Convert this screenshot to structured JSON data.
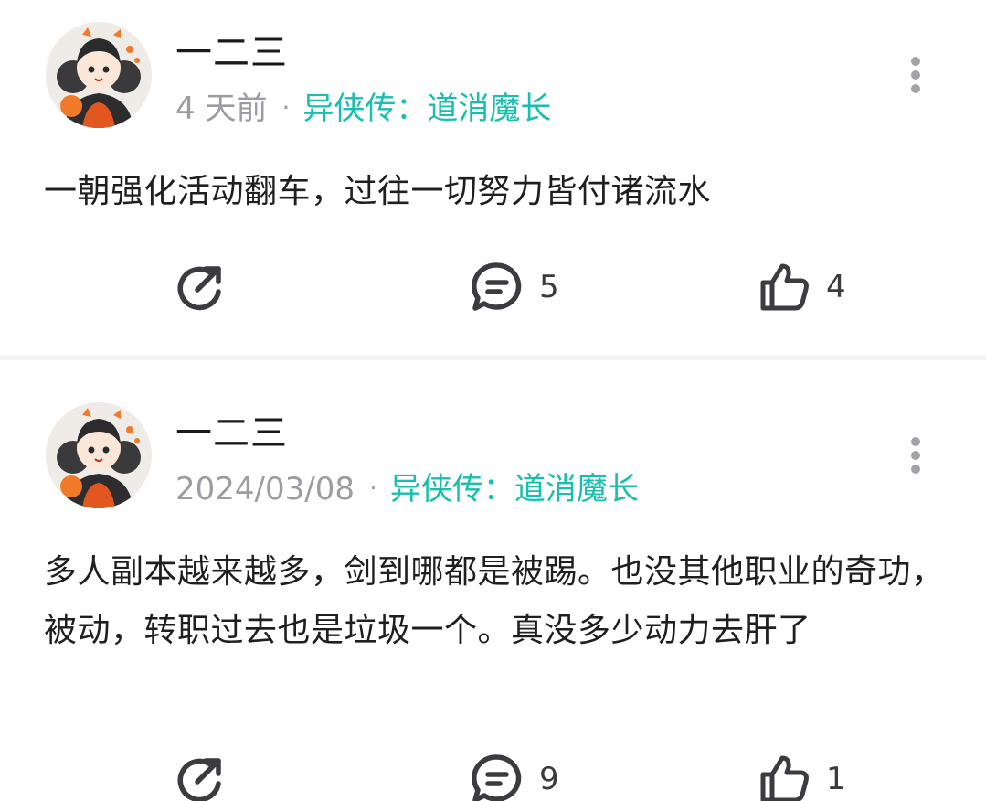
{
  "posts": [
    {
      "username": "一二三",
      "time": "4 天前",
      "separator": "·",
      "game": "异侠传：道消魔长",
      "content": "一朝强化活动翻车，过往一切努力皆付诸流水",
      "comments": "5",
      "likes": "4"
    },
    {
      "username": "一二三",
      "time": "2024/03/08",
      "separator": "·",
      "game": "异侠传：道消魔长",
      "content": "多人副本越来越多，剑到哪都是被踢。也没其他职业的奇功，被动，转职过去也是垃圾一个。真没多少动力去肝了",
      "comments": "9",
      "likes": "1"
    }
  ],
  "icons": {
    "share": "share-icon",
    "comment": "comment-icon",
    "like": "thumbs-up-icon",
    "more": "more-vertical-icon"
  },
  "colors": {
    "accent": "#17bfae",
    "meta_gray": "#9c9ca3",
    "icon_gray": "#3b3b40"
  }
}
